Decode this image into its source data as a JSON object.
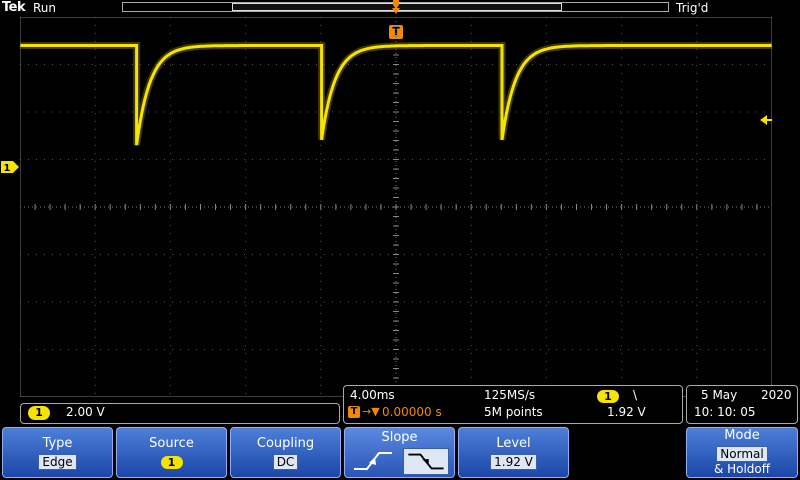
{
  "header": {
    "brand": "Tek",
    "run_state": "Run",
    "trigger_state": "Trig'd"
  },
  "markers": {
    "trigger_position_label": "T",
    "channel_label": "1"
  },
  "colors": {
    "trace": "#f4e400",
    "trigger": "#f08a00",
    "softkey_blue": "#2a58bd"
  },
  "waveform": {
    "channel": "1",
    "high_divs_above_center": 3.4,
    "low_divs_above_center": 1.3,
    "edge_times_divs": [
      1.55,
      4.0,
      6.4
    ],
    "time_constant_divs": 0.18,
    "shape": "exponential recovery after falling edge"
  },
  "readouts": {
    "ch1_badge": "1",
    "ch1_scale": "2.00 V",
    "time_per_div": "4.00ms",
    "sample_rate": "125MS/s",
    "trigger_source_badge": "1",
    "trigger_slope_symbol": "\\",
    "trigger_delay_box": "T",
    "trigger_delay_arrow": "→▼",
    "trigger_delay": "0.00000 s",
    "record_length": "5M points",
    "trigger_level": "1.92 V",
    "date": "5 May",
    "year": "2020",
    "time": "10: 10: 05"
  },
  "softkeys": {
    "type": {
      "title": "Type",
      "value": "Edge"
    },
    "source": {
      "title": "Source",
      "value": "1"
    },
    "coupling": {
      "title": "Coupling",
      "value": "DC"
    },
    "slope": {
      "title": "Slope",
      "selected": "falling"
    },
    "level": {
      "title": "Level",
      "value": "1.92 V"
    },
    "mode": {
      "title": "Mode",
      "value": "Normal",
      "line2": "& Holdoff"
    }
  }
}
